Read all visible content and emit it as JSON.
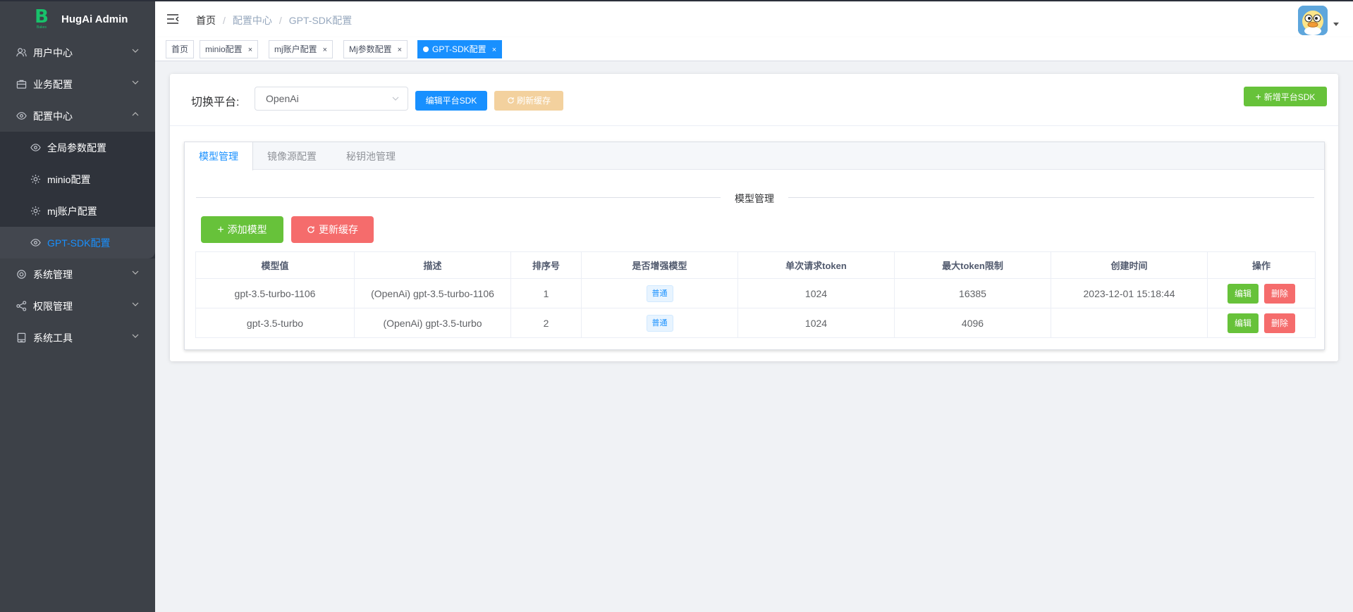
{
  "app": {
    "title": "HugAi Admin",
    "logo_letter": "B",
    "logo_sub": "Bakes"
  },
  "sidebar": {
    "items": [
      {
        "label": "用户中心",
        "icon": "user-icon"
      },
      {
        "label": "业务配置",
        "icon": "briefcase-icon"
      },
      {
        "label": "配置中心",
        "icon": "eye-icon"
      },
      {
        "label": "系统管理",
        "icon": "gear-icon"
      },
      {
        "label": "权限管理",
        "icon": "share-icon"
      },
      {
        "label": "系统工具",
        "icon": "tool-icon"
      }
    ],
    "submenu": [
      {
        "label": "全局参数配置",
        "icon": "eye-icon"
      },
      {
        "label": "minio配置",
        "icon": "gear-icon"
      },
      {
        "label": "mj账户配置",
        "icon": "gear-icon"
      },
      {
        "label": "GPT-SDK配置",
        "icon": "eye-icon"
      }
    ]
  },
  "header": {
    "breadcrumb": [
      "首页",
      "配置中心",
      "GPT-SDK配置"
    ]
  },
  "tags": [
    {
      "label": "首页"
    },
    {
      "label": "minio配置"
    },
    {
      "label": "mj账户配置"
    },
    {
      "label": "Mj参数配置"
    },
    {
      "label": "GPT-SDK配置",
      "active": true
    }
  ],
  "toolbar": {
    "platform_label": "切换平台:",
    "platform_value": "OpenAi",
    "edit_platform": "编辑平台SDK",
    "refresh_cache": "刷新缓存",
    "new_sdk": "新增平台SDK"
  },
  "tabs": [
    "模型管理",
    "镜像源配置",
    "秘钥池管理"
  ],
  "section": {
    "title": "模型管理",
    "add_model": "添加模型",
    "update_cache": "更新缓存"
  },
  "table": {
    "headers": [
      "模型值",
      "描述",
      "排序号",
      "是否增强模型",
      "单次请求token",
      "最大token限制",
      "创建时间",
      "操作"
    ],
    "rows": [
      {
        "model": "gpt-3.5-turbo-1106",
        "desc": "(OpenAi) gpt-3.5-turbo-1106",
        "sort": "1",
        "enhanced": "普通",
        "req_token": "1024",
        "max_token": "16385",
        "created": "2023-12-01 15:18:44",
        "edit": "编辑",
        "del": "删除"
      },
      {
        "model": "gpt-3.5-turbo",
        "desc": "(OpenAi) gpt-3.5-turbo",
        "sort": "2",
        "enhanced": "普通",
        "req_token": "1024",
        "max_token": "4096",
        "created": "",
        "edit": "编辑",
        "del": "删除"
      }
    ]
  },
  "colors": {
    "primary": "#1890ff",
    "success": "#67c23a",
    "danger": "#f56c6c",
    "warning_light": "#f3d19e",
    "sidebar_bg": "#3d4148"
  }
}
